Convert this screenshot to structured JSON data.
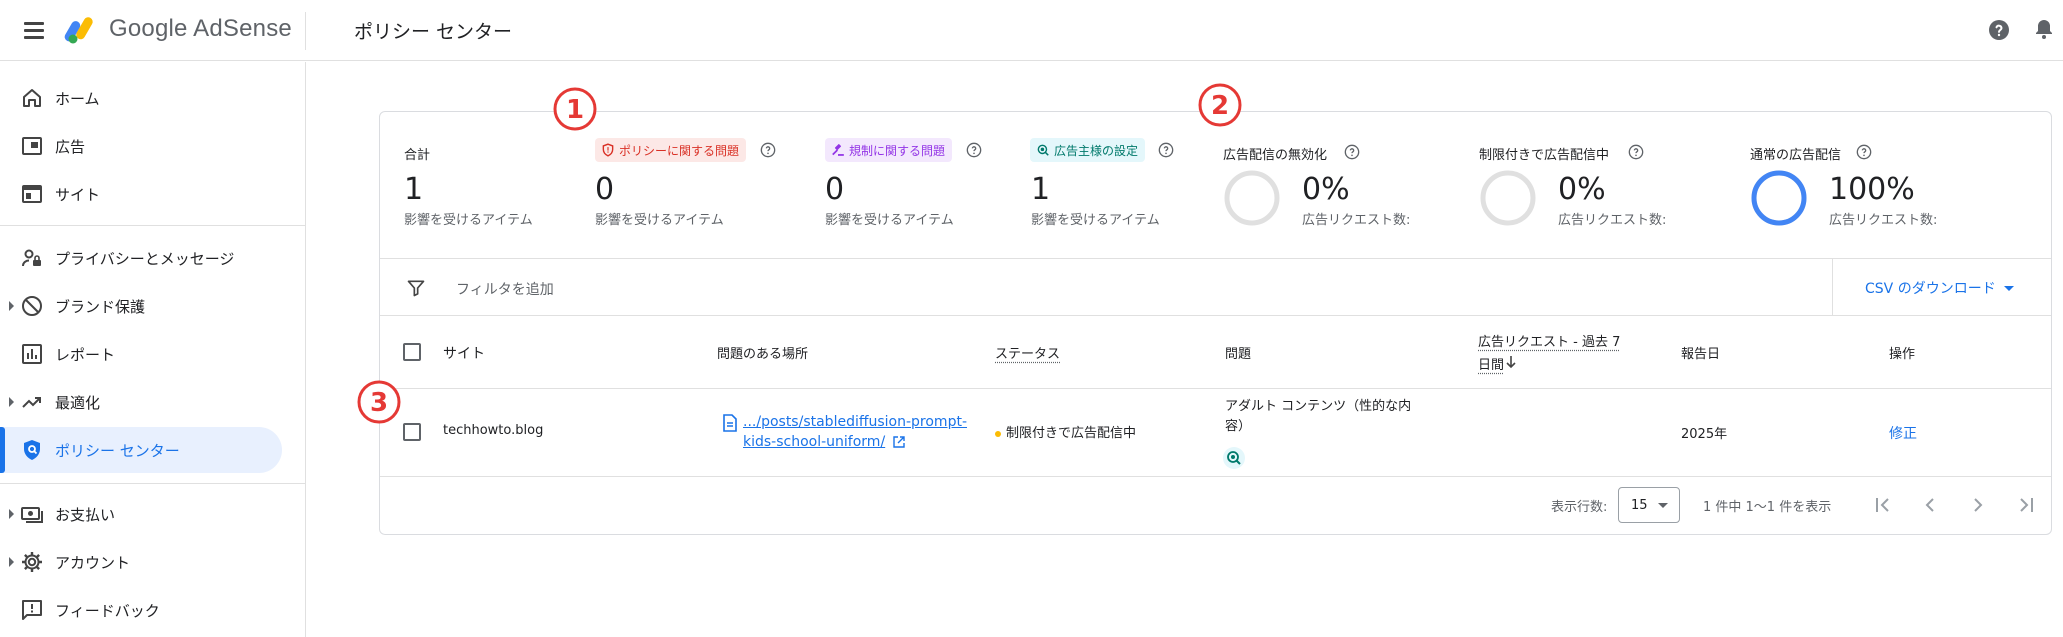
{
  "header": {
    "brand": "Google AdSense",
    "page_title": "ポリシー センター"
  },
  "sidebar": {
    "items": [
      {
        "label": "ホーム",
        "icon": "home-icon"
      },
      {
        "label": "広告",
        "icon": "ads-icon"
      },
      {
        "label": "サイト",
        "icon": "sites-icon"
      },
      {
        "label": "プライバシーとメッセージ",
        "icon": "privacy-icon"
      },
      {
        "label": "ブランド保護",
        "icon": "block-icon"
      },
      {
        "label": "レポート",
        "icon": "reports-icon"
      },
      {
        "label": "最適化",
        "icon": "trending-icon"
      },
      {
        "label": "ポリシー センター",
        "icon": "shield-icon",
        "active": true
      },
      {
        "label": "お支払い",
        "icon": "payments-icon"
      },
      {
        "label": "アカウント",
        "icon": "gear-icon"
      },
      {
        "label": "フィードバック",
        "icon": "feedback-icon"
      }
    ]
  },
  "summary": {
    "total": {
      "label": "合計",
      "value": "1",
      "sub": "影響を受けるアイテム"
    },
    "policy": {
      "label": "ポリシーに関する問題",
      "value": "0",
      "sub": "影響を受けるアイテム",
      "color": "#d93025"
    },
    "regulation": {
      "label": "規制に関する問題",
      "value": "0",
      "sub": "影響を受けるアイテム",
      "color": "#9334e6"
    },
    "advertiser": {
      "label": "広告主様の設定",
      "value": "1",
      "sub": "影響を受けるアイテム",
      "color": "#129eaf"
    },
    "disabled": {
      "label": "広告配信の無効化",
      "pct": "0%",
      "sub": "広告リクエスト数:",
      "fill": 0
    },
    "restricted": {
      "label": "制限付きで広告配信中",
      "pct": "0%",
      "sub": "広告リクエスト数:",
      "fill": 0
    },
    "normal": {
      "label": "通常の広告配信",
      "pct": "100%",
      "sub": "広告リクエスト数:",
      "fill": 1
    }
  },
  "annotations": [
    "①",
    "②",
    "③"
  ],
  "filter": {
    "placeholder": "フィルタを追加",
    "csv_label": "CSV のダウンロード"
  },
  "table": {
    "headers": {
      "site": "サイト",
      "location": "問題のある場所",
      "status": "ステータス",
      "issue": "問題",
      "requests_line1": "広告リクエスト - 過去 7",
      "requests_line2": "日間",
      "report_date": "報告日",
      "action": "操作"
    },
    "rows": [
      {
        "site": "techhowto.blog",
        "location_line1": ".../posts/stablediffusion-prompt-",
        "location_line2": "kids-school-uniform/",
        "status": "制限付きで広告配信中",
        "issue_line1": "アダルト コンテンツ（性的な内",
        "issue_line2": "容）",
        "report_date": "2025年",
        "action": "修正"
      }
    ]
  },
  "pager": {
    "rows_label": "表示行数:",
    "rows_value": "15",
    "range_text": "1 件中 1〜1 件を表示"
  }
}
